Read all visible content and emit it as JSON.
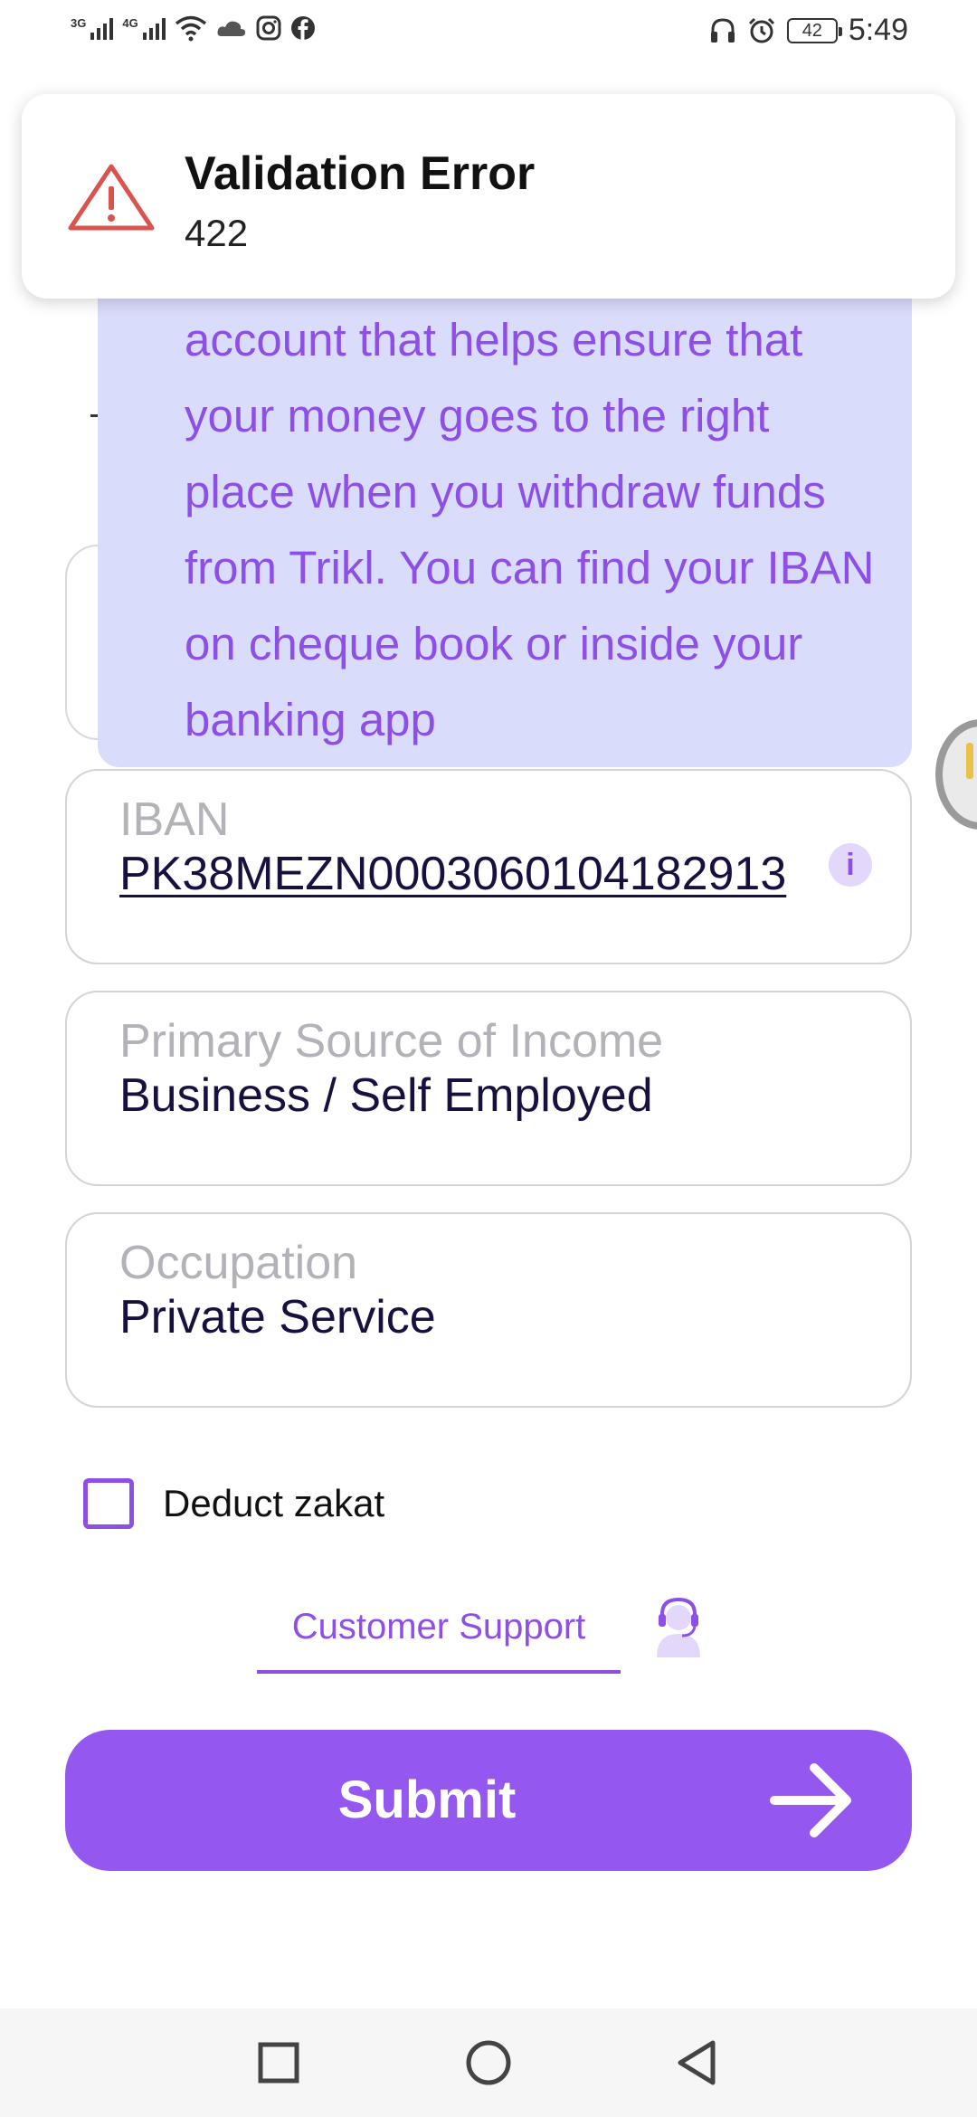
{
  "status_bar": {
    "network_1": "3G",
    "network_2": "4G",
    "battery": "42",
    "time": "5:49"
  },
  "toast": {
    "title": "Validation Error",
    "message": "422"
  },
  "tooltip": {
    "text": "account that helps ensure that your money goes to the right place when you withdraw funds from Trikl. You can find your IBAN on cheque book or inside your banking app"
  },
  "fields": {
    "iban": {
      "label": "IBAN",
      "value": "PK38MEZN0003060104182913"
    },
    "income": {
      "label": "Primary Source of Income",
      "value": "Business / Self Employed"
    },
    "occupation": {
      "label": "Occupation",
      "value": "Private Service"
    }
  },
  "zakat": {
    "label": "Deduct zakat",
    "checked": false
  },
  "support": {
    "label": "Customer Support"
  },
  "submit": {
    "label": "Submit"
  },
  "colors": {
    "accent": "#9457ef",
    "tooltip_bg": "#d9dcfb",
    "error": "#d9534f"
  }
}
